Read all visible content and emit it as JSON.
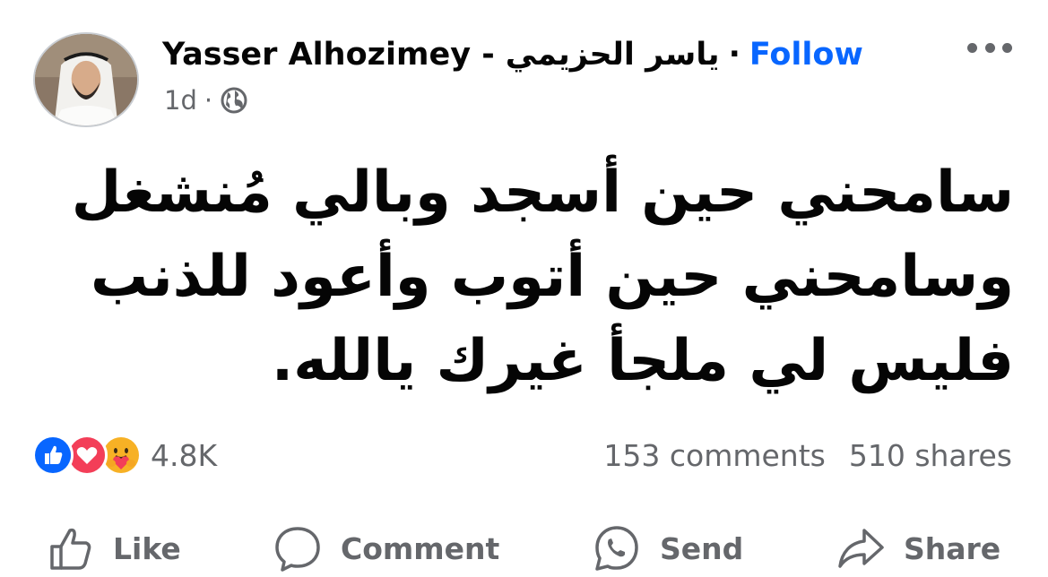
{
  "post": {
    "author_name": "Yasser Alhozimey -",
    "author_name_arabic": "ياسر الحزيمي",
    "separator": "·",
    "follow_label": "Follow",
    "time": "1d",
    "meta_separator": "·",
    "privacy_icon": "globe-icon",
    "text_lines": [
      "سامحني حين أسجد وبالي مُنشغل",
      "وسامحني حين أتوب وأعود للذنب",
      "فليس لي ملجأ غيرك يالله."
    ]
  },
  "reactions": {
    "icons": [
      "like-icon",
      "love-icon",
      "care-icon"
    ],
    "count": "4.8K"
  },
  "stats": {
    "comments": "153 comments",
    "shares": "510 shares"
  },
  "actions": {
    "like": "Like",
    "comment": "Comment",
    "send": "Send",
    "share": "Share"
  },
  "colors": {
    "follow": "#0866ff",
    "secondary_text": "#65676b",
    "like": "#0866ff",
    "love": "#f33e58",
    "care": "#f7b125"
  }
}
